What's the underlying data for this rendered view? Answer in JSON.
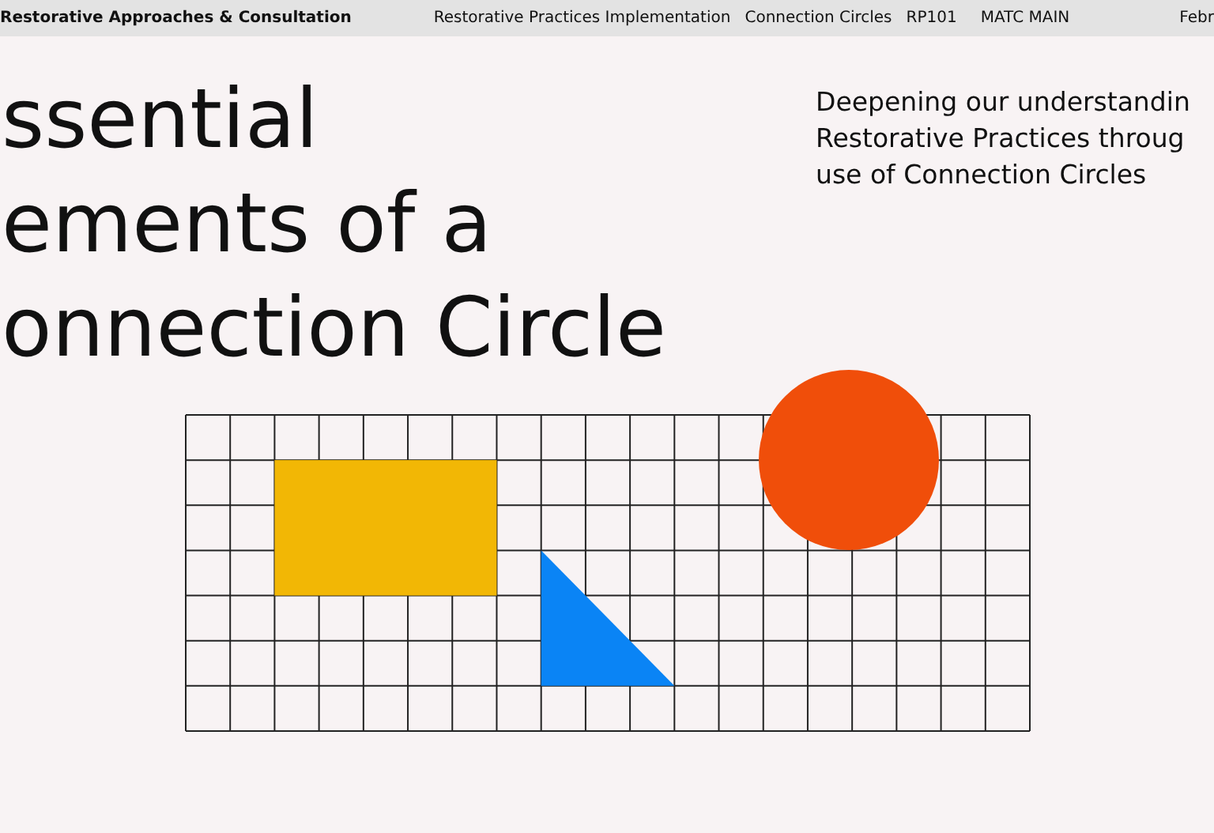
{
  "header": {
    "brand": "Restorative Approaches & Consultation",
    "nav": [
      "Restorative Practices Implementation",
      "Connection Circles",
      "RP101",
      "MATC MAIN"
    ],
    "date": "Febr"
  },
  "title_lines": [
    "ssential",
    "ements of a",
    "onnection Circle"
  ],
  "subtitle_lines": [
    "Deepening our understandin",
    "Restorative Practices throug",
    "use of Connection Circles"
  ]
}
